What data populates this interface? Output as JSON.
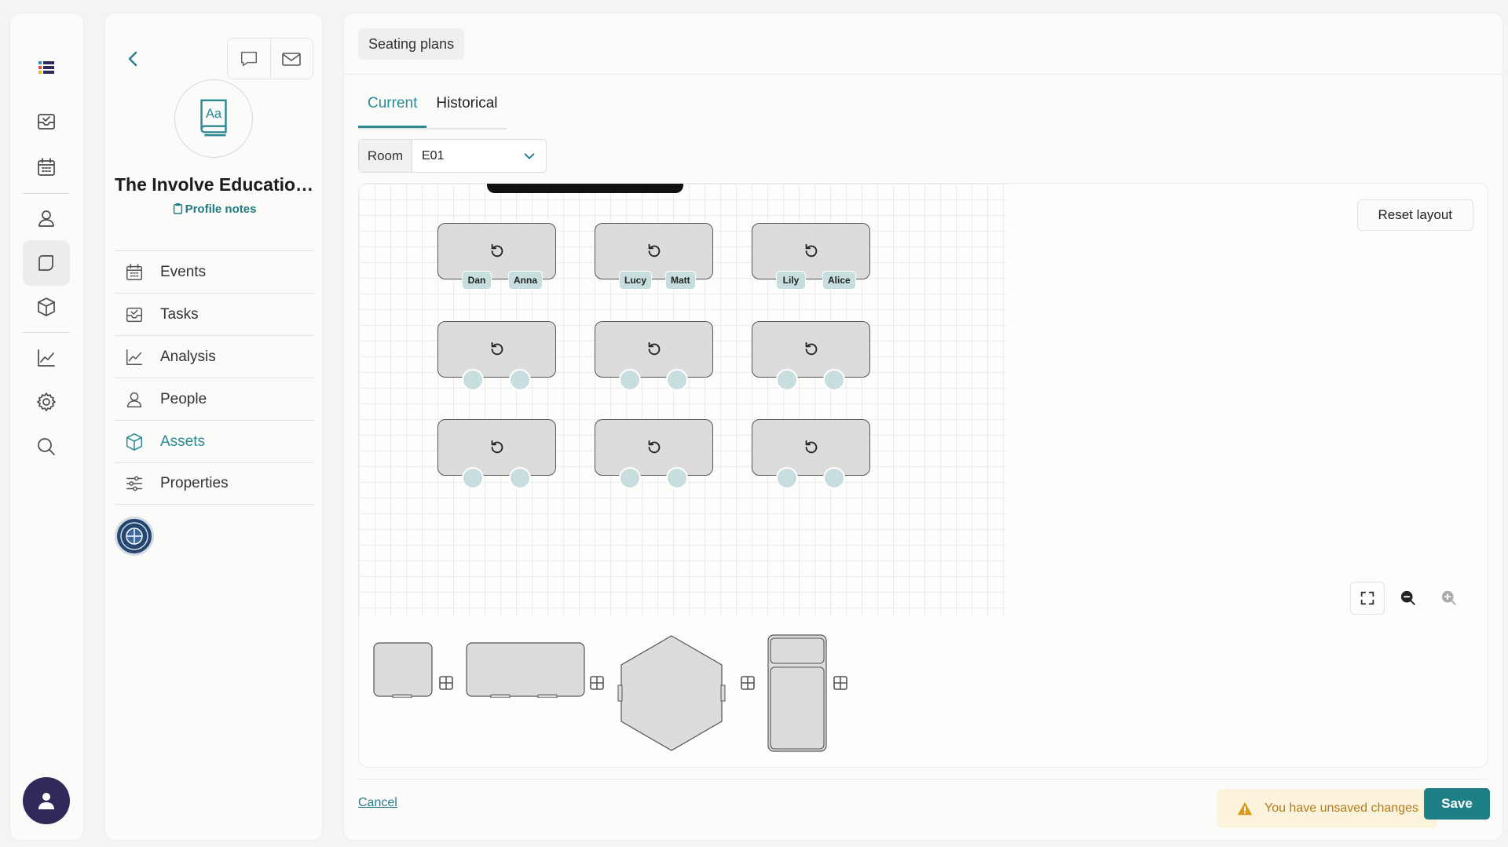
{
  "rail": {
    "items": [
      {
        "icon": "app-logo-icon"
      },
      {
        "icon": "inbox-icon"
      },
      {
        "icon": "calendar-icon"
      },
      {
        "icon": "person-icon"
      },
      {
        "icon": "chat-icon"
      },
      {
        "icon": "box-icon"
      },
      {
        "icon": "chart-icon"
      },
      {
        "icon": "gear-icon"
      },
      {
        "icon": "search-icon"
      }
    ]
  },
  "panel": {
    "org_name": "The Involve Education Trust",
    "logo_text": "Aa",
    "profile_notes": "Profile notes",
    "nav": [
      {
        "label": "Events",
        "icon": "calendar-icon"
      },
      {
        "label": "Tasks",
        "icon": "inbox-icon"
      },
      {
        "label": "Analysis",
        "icon": "chart-icon"
      },
      {
        "label": "People",
        "icon": "person-icon"
      },
      {
        "label": "Assets",
        "icon": "box-icon",
        "active": true
      },
      {
        "label": "Properties",
        "icon": "sliders-icon"
      }
    ]
  },
  "main": {
    "breadcrumb": "Seating plans",
    "tabs": [
      {
        "label": "Current",
        "active": true
      },
      {
        "label": "Historical",
        "active": false
      }
    ],
    "room": {
      "label": "Room",
      "value": "E01"
    },
    "reset_label": "Reset layout",
    "desks": [
      {
        "row": 0,
        "col": 0,
        "seats": [
          "Dan",
          "Anna"
        ]
      },
      {
        "row": 0,
        "col": 1,
        "seats": [
          "Lucy",
          "Matt"
        ]
      },
      {
        "row": 0,
        "col": 2,
        "seats": [
          "Lily",
          "Alice"
        ]
      },
      {
        "row": 1,
        "col": 0,
        "seats": [
          "",
          ""
        ]
      },
      {
        "row": 1,
        "col": 1,
        "seats": [
          "",
          ""
        ]
      },
      {
        "row": 1,
        "col": 2,
        "seats": [
          "",
          ""
        ]
      },
      {
        "row": 2,
        "col": 0,
        "seats": [
          "",
          ""
        ]
      },
      {
        "row": 2,
        "col": 1,
        "seats": [
          "",
          ""
        ]
      },
      {
        "row": 2,
        "col": 2,
        "seats": [
          "",
          ""
        ]
      }
    ],
    "cancel_label": "Cancel",
    "unsaved_text": "You have unsaved changes",
    "save_label": "Save"
  },
  "colors": {
    "accent": "#2a8a93",
    "save": "#1f7f87",
    "seat": "#c8dede",
    "warning_bg": "#fbf3dc",
    "warning_text": "#b07d1a",
    "avatar": "#2f2a5a"
  }
}
